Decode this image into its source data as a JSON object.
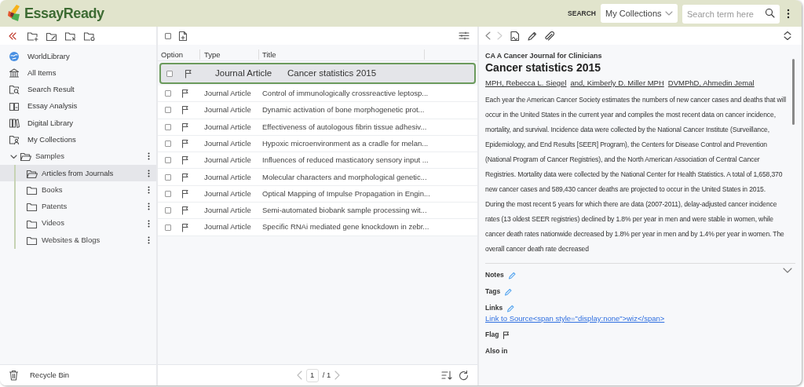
{
  "header": {
    "logo_text": "EssayReady",
    "search_label": "SEARCH",
    "scope_select": "My Collections",
    "search_field": {
      "placeholder": "Search term here"
    }
  },
  "sidebar": {
    "items": [
      {
        "label": "WorldLibrary",
        "selected": false
      },
      {
        "label": "All Items",
        "selected": false
      },
      {
        "label": "Search Result",
        "selected": false
      },
      {
        "label": "Essay Analysis",
        "selected": false
      },
      {
        "label": "Digital Library",
        "selected": false
      },
      {
        "label": "My Collections",
        "selected": false
      }
    ],
    "tree": [
      {
        "label": "Samples",
        "expanded": true,
        "selected": false,
        "children": [
          {
            "label": "Articles from Journals",
            "selected": true
          },
          {
            "label": "Books",
            "selected": false
          },
          {
            "label": "Patents",
            "selected": false
          },
          {
            "label": "Videos",
            "selected": false
          },
          {
            "label": "Websites & Blogs",
            "selected": false
          }
        ]
      }
    ],
    "footer": {
      "label": "Recycle Bin"
    }
  },
  "table": {
    "select_all_checked": false,
    "columns": [
      "Option",
      "Type",
      "Title"
    ],
    "rows": [
      {
        "checked": false,
        "selected": true,
        "type": "Journal Article",
        "title": "Cancer statistics 2015"
      },
      {
        "checked": false,
        "selected": false,
        "type": "Journal Article",
        "title": "Control of immunologically crossreactive leptosp..."
      },
      {
        "checked": false,
        "selected": false,
        "type": "Journal Article",
        "title": "Dynamic activation of bone morphogenetic prot..."
      },
      {
        "checked": false,
        "selected": false,
        "type": "Journal Article",
        "title": "Effectiveness of autologous fibrin tissue adhesiv..."
      },
      {
        "checked": false,
        "selected": false,
        "type": "Journal Article",
        "title": "Hypoxic microenvironment as a cradle for melan..."
      },
      {
        "checked": false,
        "selected": false,
        "type": "Journal Article",
        "title": "Influences of reduced masticatory sensory input ..."
      },
      {
        "checked": false,
        "selected": false,
        "type": "Journal Article",
        "title": "Molecular characters and morphological genetic..."
      },
      {
        "checked": false,
        "selected": false,
        "type": "Journal Article",
        "title": "Optical Mapping of Impulse Propagation in Engin..."
      },
      {
        "checked": false,
        "selected": false,
        "type": "Journal Article",
        "title": "Semi-automated biobank sample processing wit..."
      },
      {
        "checked": false,
        "selected": false,
        "type": "Journal Article",
        "title": "Specific RNAi mediated gene knockdown in zebr..."
      }
    ],
    "pagination": {
      "page": "1",
      "total": "/ 1"
    }
  },
  "detail": {
    "journal": "CA A Cancer Journal for Clinicians",
    "title": "Cancer statistics 2015",
    "authors": [
      "MPH, Rebecca L. Siegel",
      "and, Kimberly D. Miller MPH",
      "DVMPhD, Ahmedin Jemal"
    ],
    "abstract": "Each year the American Cancer Society estimates the numbers of new cancer cases and deaths that will occur in the United States in the current year and compiles the most recent data on cancer incidence, mortality, and survival. Incidence data were collected by the National Cancer Institute (Surveillance, Epidemiology, and End Results [SEER] Program), the Centers for Disease Control and Prevention (National Program of Cancer Registries), and the North American Association of Central Cancer Registries. Mortality data were collected by the National Center for Health Statistics. A total of 1,658,370 new cancer cases and 589,430 cancer deaths are projected to occur in the United States in 2015. During the most recent 5 years for which there are data (2007-2011), delay-adjusted cancer incidence rates (13 oldest SEER registries) declined by 1.8% per year in men and were stable in women, while cancer death rates nationwide decreased by 1.8% per year in men and by 1.4% per year in women. The overall cancer death rate decreased",
    "meta": [
      {
        "kind": "editable",
        "label": "Notes"
      },
      {
        "kind": "editable",
        "label": "Tags"
      },
      {
        "kind": "editable",
        "label": "Links",
        "link": "Link to Source<span style=\"display:none\">wiz</span>"
      },
      {
        "kind": "flag",
        "label": "Flag"
      },
      {
        "kind": "plain",
        "label": "Also in"
      }
    ]
  }
}
